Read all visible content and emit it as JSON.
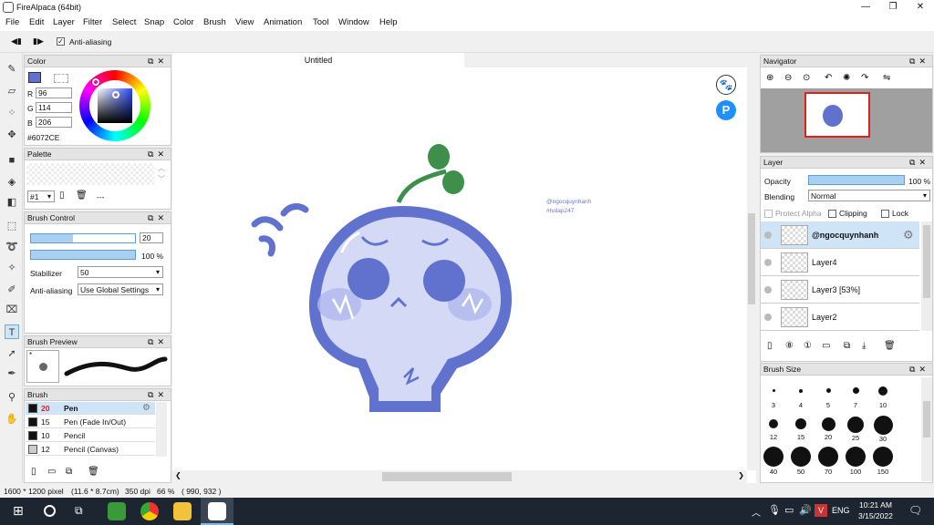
{
  "window": {
    "title": "FireAlpaca (64bit)"
  },
  "menu": [
    "File",
    "Edit",
    "Layer",
    "Filter",
    "Select",
    "Snap",
    "Color",
    "Brush",
    "View",
    "Animation",
    "Tool",
    "Window",
    "Help"
  ],
  "toolbar": {
    "antialias_label": "Anti-aliasing"
  },
  "color_panel": {
    "title": "Color",
    "r_label": "R",
    "g_label": "G",
    "b_label": "B",
    "r": "96",
    "g": "114",
    "b": "206",
    "hex": "#6072CE",
    "main_color": "#6072CE"
  },
  "palette_panel": {
    "title": "Palette",
    "selector": "#1",
    "extra": "---"
  },
  "brush_control": {
    "title": "Brush Control",
    "size": "20",
    "size_level": 0.4,
    "opacity": "100 %",
    "opacity_level": 1.0,
    "stabilizer_label": "Stabilizer",
    "stabilizer": "50",
    "antialias_label": "Anti-aliasing",
    "antialias": "Use Global Settings"
  },
  "brush_preview": {
    "title": "Brush Preview",
    "mark": "*"
  },
  "brush_panel": {
    "title": "Brush",
    "items": [
      {
        "num": "20",
        "name": "Pen"
      },
      {
        "num": "15",
        "name": "Pen (Fade In/Out)"
      },
      {
        "num": "10",
        "name": "Pencil"
      },
      {
        "num": "12",
        "name": "Pencil (Canvas)"
      }
    ]
  },
  "canvas": {
    "tab": "Untitled",
    "watermark1": "@ngocquynhanh",
    "watermark2": "#tvdap247"
  },
  "navigator": {
    "title": "Navigator"
  },
  "layer_panel": {
    "title": "Layer",
    "opacity_label": "Opacity",
    "opacity": "100 %",
    "opacity_level": 1.0,
    "blending_label": "Blending",
    "blending": "Normal",
    "protect_alpha": "Protect Alpha",
    "clipping": "Clipping",
    "lock": "Lock",
    "layers": [
      "@ngocquynhanh",
      "Layer4",
      "Layer3 [53%]",
      "Layer2"
    ]
  },
  "brush_size": {
    "title": "Brush Size",
    "sizes": [
      "3",
      "4",
      "5",
      "7",
      "10",
      "12",
      "15",
      "20",
      "25",
      "30",
      "40",
      "50",
      "70",
      "100",
      "150"
    ]
  },
  "status": {
    "dims": "1600 * 1200 pixel",
    "cm": "(11.6 * 8.7cm)",
    "dpi": "350 dpi",
    "zoom": "66 %",
    "coords": "( 990, 932 )"
  },
  "taskbar": {
    "lang": "ENG",
    "time": "10:21 AM",
    "date": "3/15/2022"
  }
}
